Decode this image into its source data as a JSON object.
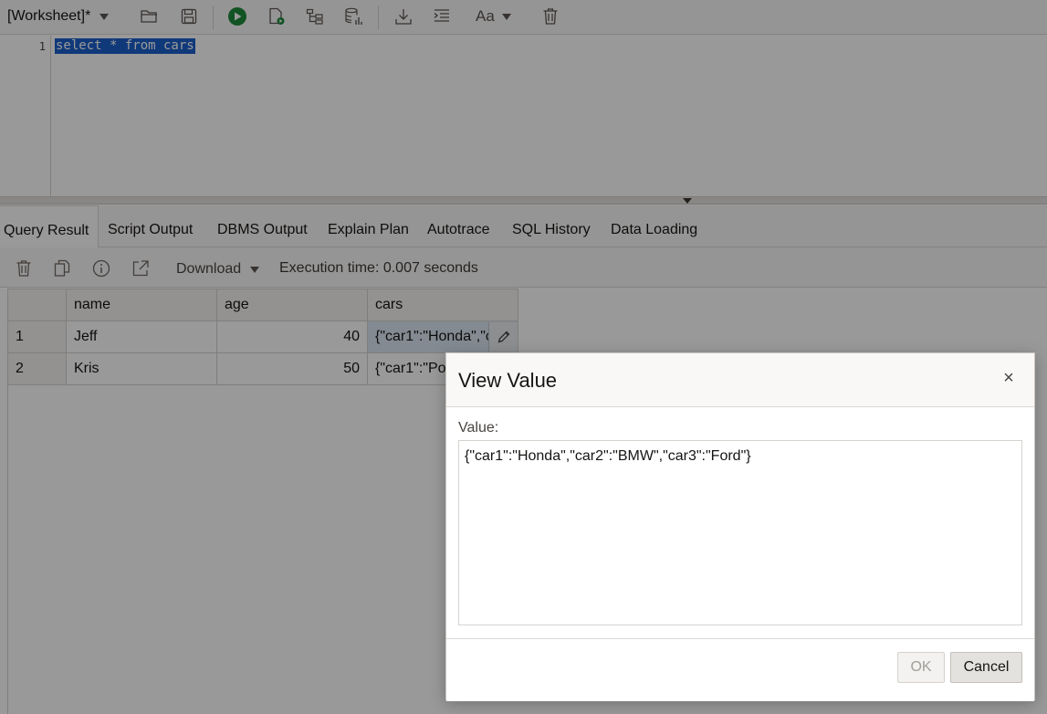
{
  "toolbar": {
    "worksheet_label": "[Worksheet]*",
    "font_label": "Aa",
    "icons": [
      "open-folder-icon",
      "save-icon",
      "run-statement-icon",
      "run-script-icon",
      "explain-plan-icon",
      "autotrace-icon",
      "download-icon",
      "format-icon",
      "font-icon",
      "clear-icon"
    ]
  },
  "editor": {
    "line_number": "1",
    "code": "select * from cars"
  },
  "tabs": [
    {
      "label": "Query Result"
    },
    {
      "label": "Script Output"
    },
    {
      "label": "DBMS Output"
    },
    {
      "label": "Explain Plan"
    },
    {
      "label": "Autotrace"
    },
    {
      "label": "SQL History"
    },
    {
      "label": "Data Loading"
    }
  ],
  "result_toolbar": {
    "download_label": "Download",
    "execution_time": "Execution time: 0.007 seconds"
  },
  "grid": {
    "columns": [
      "name",
      "age",
      "cars"
    ],
    "rows": [
      {
        "num": "1",
        "name": "Jeff",
        "age": "40",
        "cars": "{\"car1\":\"Honda\",\"c"
      },
      {
        "num": "2",
        "name": "Kris",
        "age": "50",
        "cars": "{\"car1\":\"Po"
      }
    ]
  },
  "dialog": {
    "title": "View Value",
    "close_glyph": "×",
    "value_label": "Value:",
    "value": "{\"car1\":\"Honda\",\"car2\":\"BMW\",\"car3\":\"Ford\"}",
    "ok_label": "OK",
    "cancel_label": "Cancel"
  },
  "colors": {
    "selection": "#1b5fcc",
    "run_green": "#1e8a3c",
    "overlay": "rgba(0,0,0,0.40)"
  }
}
